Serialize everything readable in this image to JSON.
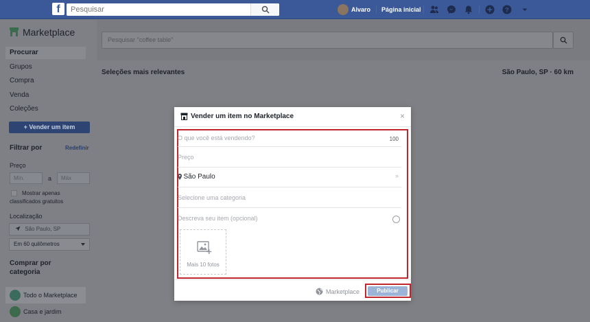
{
  "colors": {
    "brand": "#3b5998",
    "highlight": "#c1262d",
    "publish": "#9cb4d8"
  },
  "topbar": {
    "search_placeholder": "Pesquisar",
    "user_name": "Alvaro",
    "home_link": "Página inicial",
    "icons": [
      "friends-icon",
      "messenger-icon",
      "bell-icon",
      "create-icon",
      "help-icon",
      "dropdown-icon"
    ]
  },
  "sidebar": {
    "title": "Marketplace",
    "nav": [
      "Procurar",
      "Grupos",
      "Compra",
      "Venda",
      "Coleções"
    ],
    "sell_button": "+ Vender um item",
    "filter_heading": "Filtrar por",
    "reset_link": "Redefinir",
    "price_label": "Preço",
    "price_min": "Mín.",
    "price_to": "a",
    "price_max": "Máx",
    "free_only": [
      "Mostrar apenas",
      "classificados gratuitos"
    ],
    "location_label": "Localização",
    "location_value": "São Paulo, SP",
    "distance_value": "Em 60 quilômetros",
    "category_heading": [
      "Comprar por",
      "categoria"
    ],
    "categories": [
      "Todo o Marketplace",
      "Casa e jardim"
    ]
  },
  "main": {
    "search_placeholder": "Pesquisar \"coffee table\"",
    "section_title": "Seleções mais relevantes",
    "location": "São Paulo, SP · 60 km"
  },
  "modal": {
    "title": "Vender um item no Marketplace",
    "close": "×",
    "what_placeholder": "O que você está vendendo?",
    "char_count": "100",
    "price_placeholder": "Preço",
    "city": "São Paulo",
    "city_arrow": "»",
    "category_placeholder": "Selecione uma categoria",
    "description_placeholder": "Descreva seu item (opcional)",
    "photos_label": "Mais 10 fotos",
    "audience": "Marketplace",
    "publish": "Publicar"
  }
}
